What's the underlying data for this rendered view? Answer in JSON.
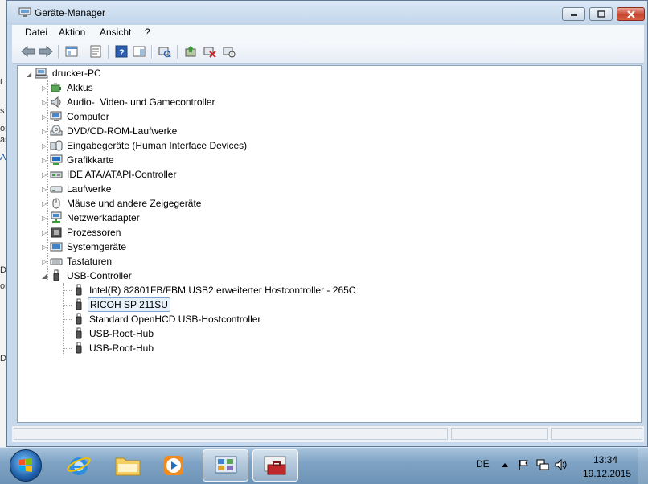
{
  "window": {
    "title": "Geräte-Manager"
  },
  "menu": [
    "Datei",
    "Aktion",
    "Ansicht",
    "?"
  ],
  "tree": {
    "root": "drucker-PC",
    "categories": [
      {
        "label": "Akkus",
        "icon": "battery-icon"
      },
      {
        "label": "Audio-, Video- und Gamecontroller",
        "icon": "speaker-icon"
      },
      {
        "label": "Computer",
        "icon": "computer-icon"
      },
      {
        "label": "DVD/CD-ROM-Laufwerke",
        "icon": "dvd-drive-icon"
      },
      {
        "label": "Eingabegeräte (Human Interface Devices)",
        "icon": "hid-icon"
      },
      {
        "label": "Grafikkarte",
        "icon": "display-adapter-icon"
      },
      {
        "label": "IDE ATA/ATAPI-Controller",
        "icon": "ide-controller-icon"
      },
      {
        "label": "Laufwerke",
        "icon": "disk-drive-icon"
      },
      {
        "label": "Mäuse und andere Zeigegeräte",
        "icon": "mouse-icon"
      },
      {
        "label": "Netzwerkadapter",
        "icon": "network-adapter-icon"
      },
      {
        "label": "Prozessoren",
        "icon": "processor-icon"
      },
      {
        "label": "Systemgeräte",
        "icon": "system-device-icon"
      },
      {
        "label": "Tastaturen",
        "icon": "keyboard-icon"
      },
      {
        "label": "USB-Controller",
        "icon": "usb-icon"
      }
    ],
    "usb_children": [
      "Intel(R) 82801FB/FBM USB2 erweiterter Hostcontroller - 265C",
      "RICOH SP 211SU",
      "Standard OpenHCD USB-Hostcontroller",
      "USB-Root-Hub",
      "USB-Root-Hub"
    ],
    "selected_child": "RICOH SP 211SU"
  },
  "background_window_fragments": [
    "t",
    "s",
    "or",
    "as",
    "A",
    "D",
    "or",
    "D"
  ],
  "taskbar": {
    "language": "DE"
  },
  "clock": {
    "time": "13:34",
    "date": "19.12.2015"
  },
  "colors": {
    "selection_border": "#7da2ce",
    "selection_fill": "#e8f0fa",
    "close_button": "#c7452f"
  }
}
